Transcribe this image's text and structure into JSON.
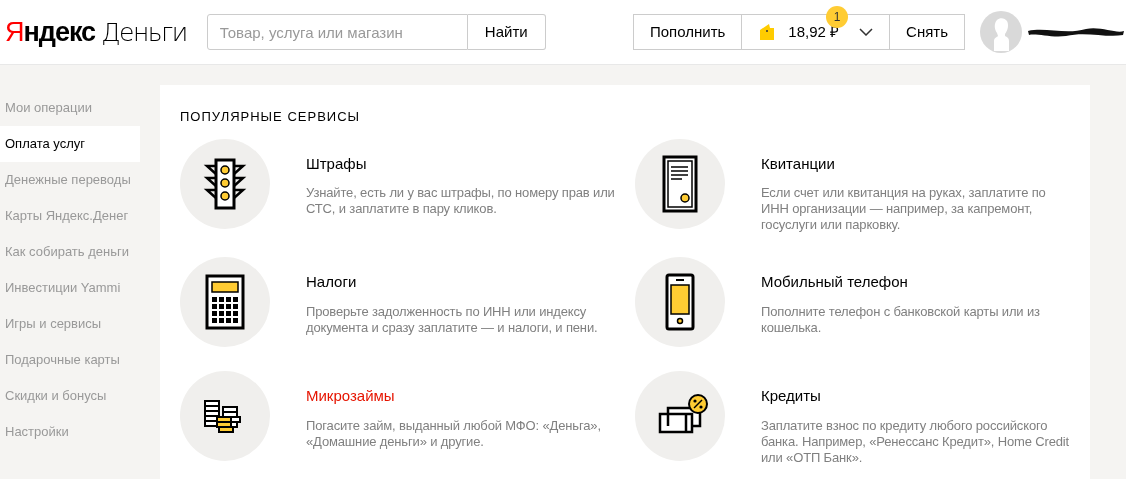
{
  "header": {
    "logo": {
      "mark": "Я",
      "rest": "ндекс",
      "product": "Деньги"
    },
    "search": {
      "placeholder": "Товар, услуга или магазин",
      "button": "Найти"
    },
    "wallet": {
      "top_up": "Пополнить",
      "balance": "18,92 ₽",
      "badge": "1",
      "withdraw": "Снять"
    }
  },
  "sidebar": {
    "items": [
      {
        "label": "Мои операции",
        "selected": false
      },
      {
        "label": "Оплата услуг",
        "selected": true
      },
      {
        "label": "Денежные переводы",
        "selected": false
      },
      {
        "label": "Карты Яндекс.Денег",
        "selected": false
      },
      {
        "label": "Как собирать деньги",
        "selected": false
      },
      {
        "label": "Инвестиции Yammi",
        "selected": false
      },
      {
        "label": "Игры и сервисы",
        "selected": false
      },
      {
        "label": "Подарочные карты",
        "selected": false
      },
      {
        "label": "Скидки и бонусы",
        "selected": false
      },
      {
        "label": "Настройки",
        "selected": false
      }
    ]
  },
  "services": {
    "title": "ПОПУЛЯРНЫЕ СЕРВИСЫ",
    "items": [
      {
        "kind": "traffic",
        "title": "Штрафы",
        "description": "Узнайте, есть ли у вас штрафы, по номеру прав или СТС, и заплатите в пару кликов.",
        "highlighted": false
      },
      {
        "kind": "receipt",
        "title": "Квитанции",
        "description": "Если счет или квитанция на руках, заплатите по ИНН организации — например, за капремонт, госуслуги или парковку.",
        "highlighted": false
      },
      {
        "kind": "calculator",
        "title": "Налоги",
        "description": "Проверьте задолженность по ИНН или индексу документа и сразу заплатите — и налоги, и пени.",
        "highlighted": false
      },
      {
        "kind": "phone",
        "title": "Мобильный телефон",
        "description": "Пополните телефон с банковской карты или из кошелька.",
        "highlighted": false
      },
      {
        "kind": "coins",
        "title": "Микрозаймы",
        "description": "Погасите займ, выданный любой МФО: «Деньга», «Домашние деньги» и другие.",
        "highlighted": true
      },
      {
        "kind": "credit",
        "title": "Кредиты",
        "description": "Заплатите взнос по кредиту любого российского банка. Например, «Ренессанс Кредит», Home Credit или «ОТП Банк».",
        "highlighted": false
      }
    ]
  }
}
